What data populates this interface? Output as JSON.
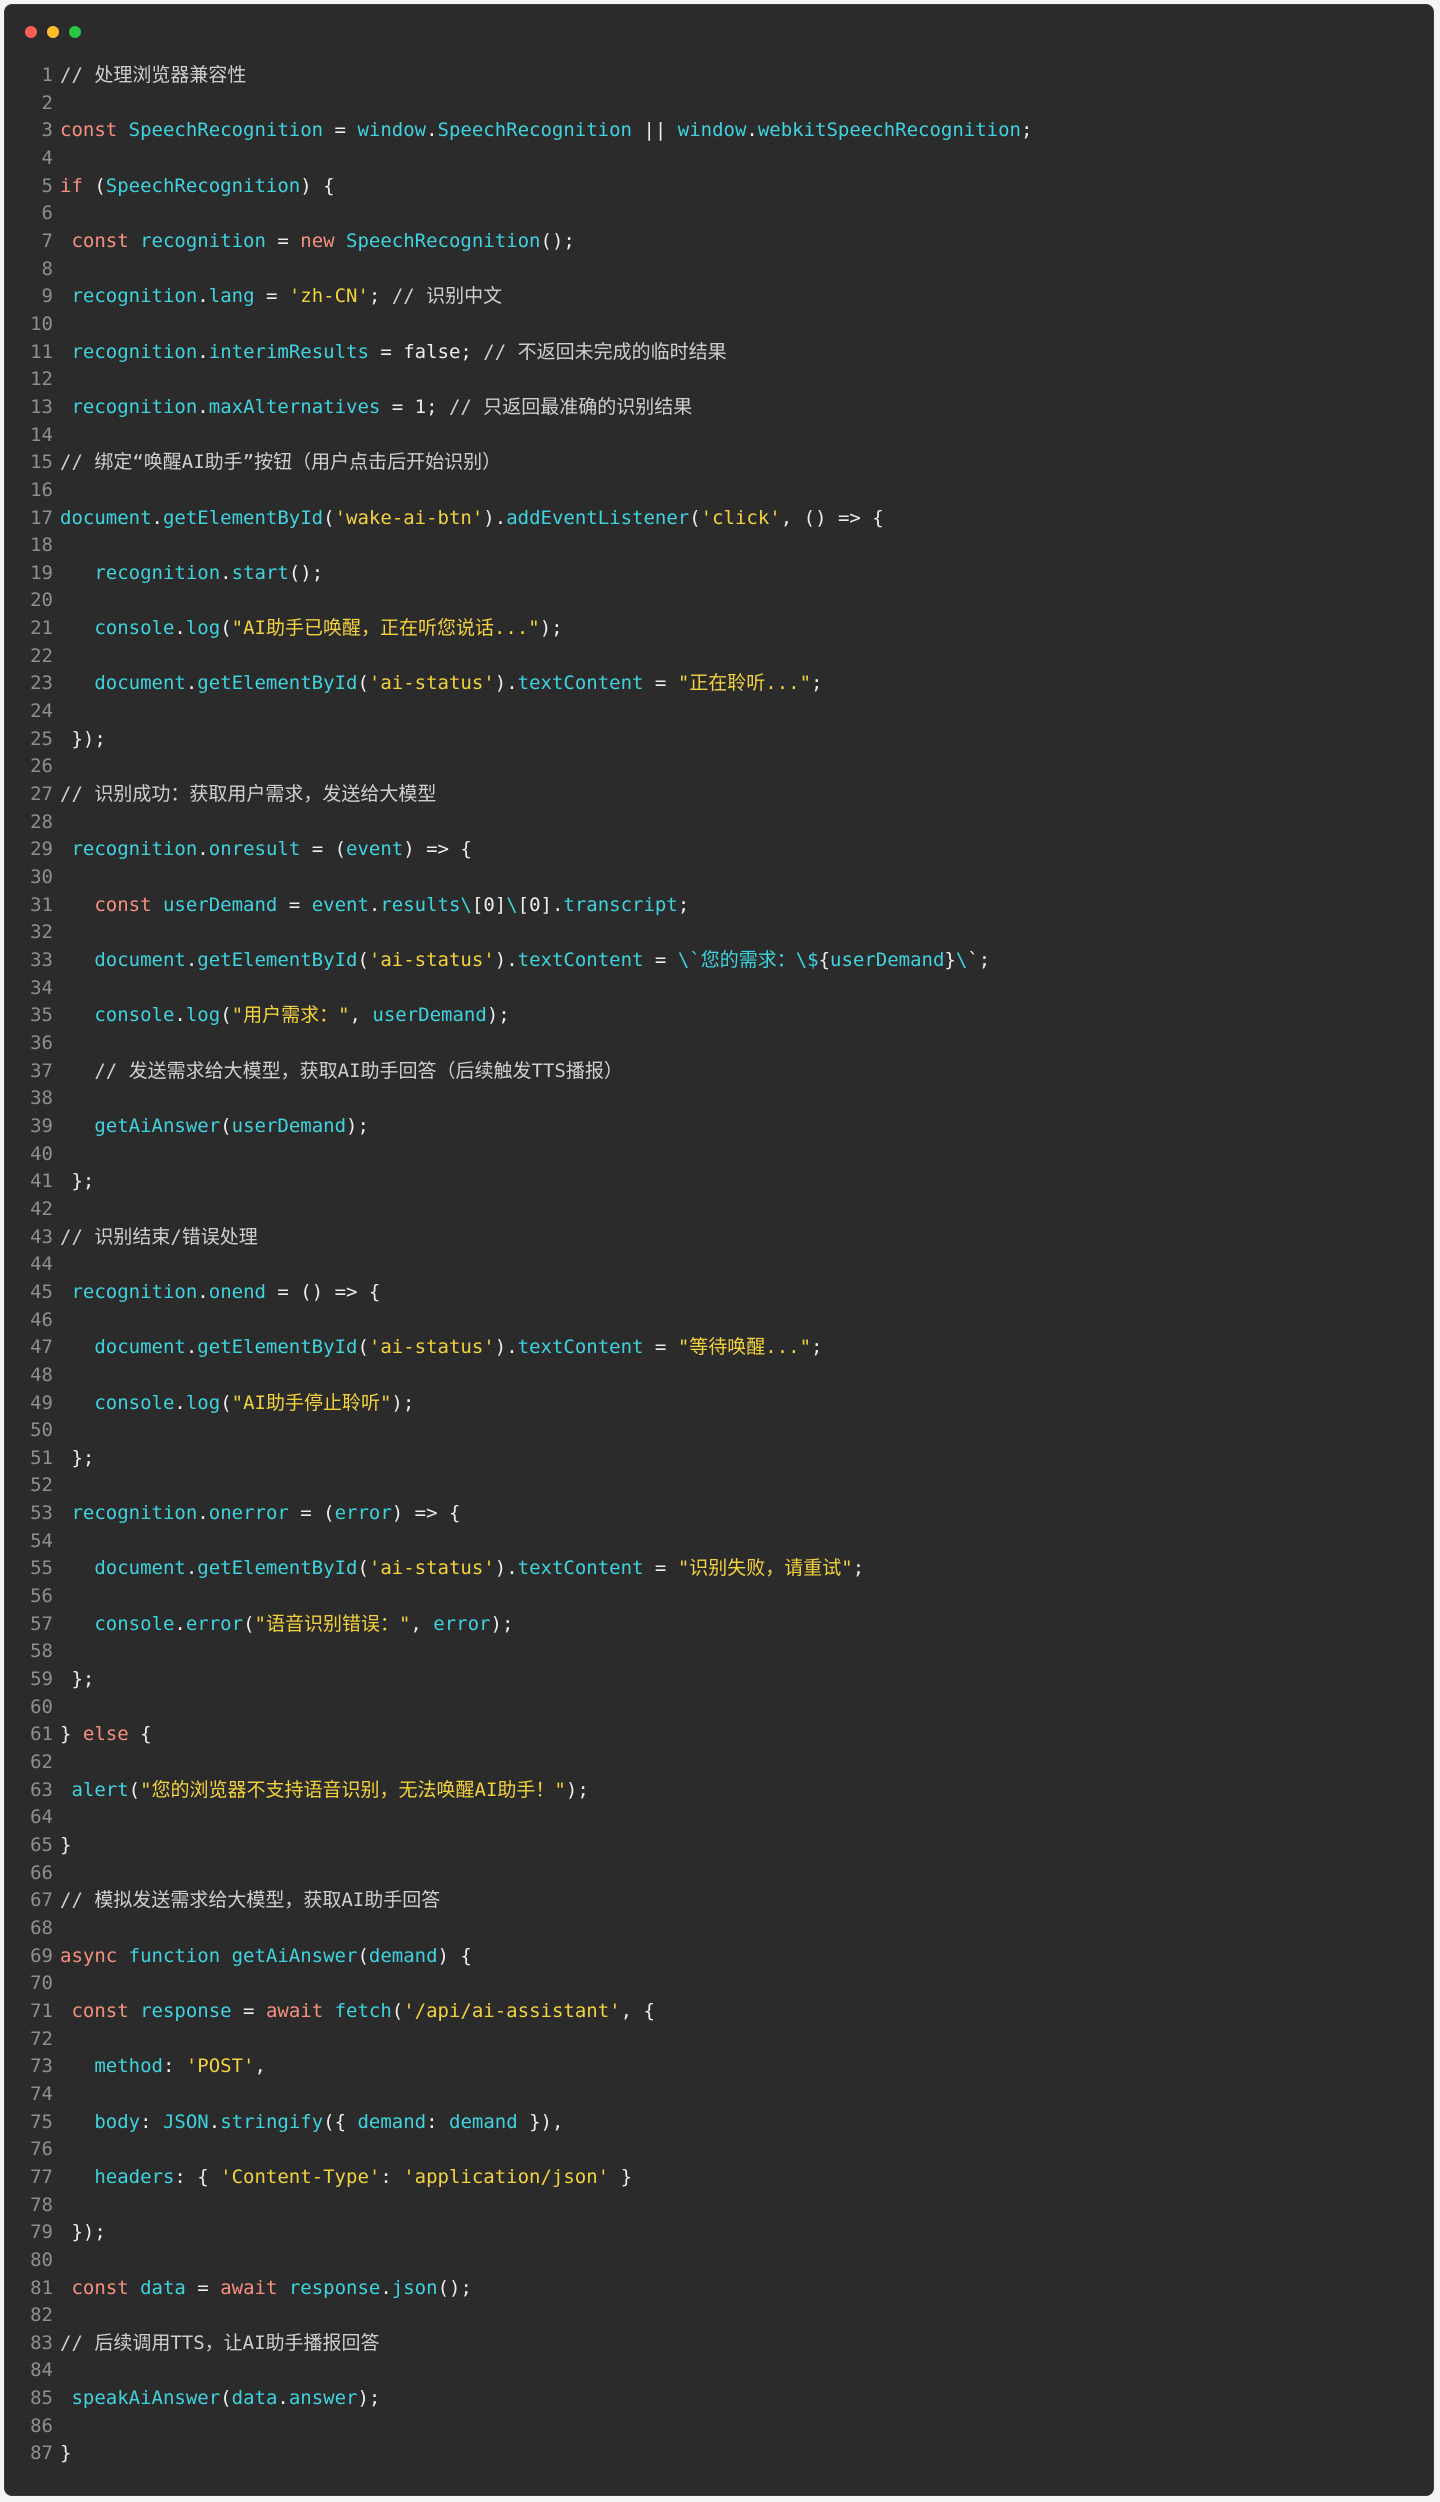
{
  "window": {
    "controls": [
      "close",
      "minimize",
      "zoom"
    ]
  },
  "colors": {
    "background": "#2b2b2b",
    "keyword": "#f6907f",
    "identifier": "#3fd3df",
    "string": "#f3d240",
    "comment": "#cfcfcf",
    "plain": "#ededed",
    "line_number": "#8f8f8f"
  },
  "editor": {
    "lines": [
      [
        [
          "cm",
          "// 处理浏览器兼容性"
        ]
      ],
      [],
      [
        [
          "kw",
          "const "
        ],
        [
          "id",
          "SpeechRecognition"
        ],
        [
          "pl",
          " = "
        ],
        [
          "id",
          "window"
        ],
        [
          "pl",
          "."
        ],
        [
          "id",
          "SpeechRecognition"
        ],
        [
          "pl",
          " || "
        ],
        [
          "id",
          "window"
        ],
        [
          "pl",
          "."
        ],
        [
          "id",
          "webkitSpeechRecognition"
        ],
        [
          "pl",
          ";"
        ]
      ],
      [],
      [
        [
          "kw",
          "if "
        ],
        [
          "pl",
          "("
        ],
        [
          "id",
          "SpeechRecognition"
        ],
        [
          "pl",
          ") {"
        ]
      ],
      [],
      [
        [
          "pl",
          " "
        ],
        [
          "kw",
          "const "
        ],
        [
          "id",
          "recognition"
        ],
        [
          "pl",
          " = "
        ],
        [
          "kw",
          "new "
        ],
        [
          "id",
          "SpeechRecognition"
        ],
        [
          "pl",
          "();"
        ]
      ],
      [],
      [
        [
          "pl",
          " "
        ],
        [
          "id",
          "recognition"
        ],
        [
          "pl",
          "."
        ],
        [
          "id",
          "lang"
        ],
        [
          "pl",
          " = "
        ],
        [
          "str",
          "'zh-CN'"
        ],
        [
          "pl",
          "; "
        ],
        [
          "cm",
          "// 识别中文"
        ]
      ],
      [],
      [
        [
          "pl",
          " "
        ],
        [
          "id",
          "recognition"
        ],
        [
          "pl",
          "."
        ],
        [
          "id",
          "interimResults"
        ],
        [
          "pl",
          " = false; "
        ],
        [
          "cm",
          "// 不返回未完成的临时结果"
        ]
      ],
      [],
      [
        [
          "pl",
          " "
        ],
        [
          "id",
          "recognition"
        ],
        [
          "pl",
          "."
        ],
        [
          "id",
          "maxAlternatives"
        ],
        [
          "pl",
          " = 1; "
        ],
        [
          "cm",
          "// 只返回最准确的识别结果"
        ]
      ],
      [],
      [
        [
          "cm",
          "// 绑定“唤醒AI助手”按钮（用户点击后开始识别）"
        ]
      ],
      [],
      [
        [
          "id",
          "document"
        ],
        [
          "pl",
          "."
        ],
        [
          "id",
          "getElementById"
        ],
        [
          "pl",
          "("
        ],
        [
          "str",
          "'wake-ai-btn'"
        ],
        [
          "pl",
          ")."
        ],
        [
          "id",
          "addEventListener"
        ],
        [
          "pl",
          "("
        ],
        [
          "str",
          "'click'"
        ],
        [
          "pl",
          ", () => {"
        ]
      ],
      [],
      [
        [
          "pl",
          "   "
        ],
        [
          "id",
          "recognition"
        ],
        [
          "pl",
          "."
        ],
        [
          "id",
          "start"
        ],
        [
          "pl",
          "();"
        ]
      ],
      [],
      [
        [
          "pl",
          "   "
        ],
        [
          "id",
          "console"
        ],
        [
          "pl",
          "."
        ],
        [
          "id",
          "log"
        ],
        [
          "pl",
          "("
        ],
        [
          "str",
          "\"AI助手已唤醒，正在听您说话...\""
        ],
        [
          "pl",
          ");"
        ]
      ],
      [],
      [
        [
          "pl",
          "   "
        ],
        [
          "id",
          "document"
        ],
        [
          "pl",
          "."
        ],
        [
          "id",
          "getElementById"
        ],
        [
          "pl",
          "("
        ],
        [
          "str",
          "'ai-status'"
        ],
        [
          "pl",
          ")."
        ],
        [
          "id",
          "textContent"
        ],
        [
          "pl",
          " = "
        ],
        [
          "str",
          "\"正在聆听...\""
        ],
        [
          "pl",
          ";"
        ]
      ],
      [],
      [
        [
          "pl",
          " });"
        ]
      ],
      [],
      [
        [
          "cm",
          "// 识别成功：获取用户需求，发送给大模型"
        ]
      ],
      [],
      [
        [
          "pl",
          " "
        ],
        [
          "id",
          "recognition"
        ],
        [
          "pl",
          "."
        ],
        [
          "id",
          "onresult"
        ],
        [
          "pl",
          " = ("
        ],
        [
          "id",
          "event"
        ],
        [
          "pl",
          ") => {"
        ]
      ],
      [],
      [
        [
          "pl",
          "   "
        ],
        [
          "kw",
          "const "
        ],
        [
          "id",
          "userDemand"
        ],
        [
          "pl",
          " = "
        ],
        [
          "id",
          "event"
        ],
        [
          "pl",
          "."
        ],
        [
          "id",
          "results"
        ],
        [
          "id",
          "\\"
        ],
        [
          "pl",
          "[0]"
        ],
        [
          "id",
          "\\"
        ],
        [
          "pl",
          "[0]."
        ],
        [
          "id",
          "transcript"
        ],
        [
          "pl",
          ";"
        ]
      ],
      [],
      [
        [
          "pl",
          "   "
        ],
        [
          "id",
          "document"
        ],
        [
          "pl",
          "."
        ],
        [
          "id",
          "getElementById"
        ],
        [
          "pl",
          "("
        ],
        [
          "str",
          "'ai-status'"
        ],
        [
          "pl",
          ")."
        ],
        [
          "id",
          "textContent"
        ],
        [
          "pl",
          " = "
        ],
        [
          "id",
          "\\`您的需求：\\$"
        ],
        [
          "pl",
          "{"
        ],
        [
          "id",
          "userDemand"
        ],
        [
          "pl",
          "}"
        ],
        [
          "id",
          "\\"
        ],
        [
          "pl",
          "`;"
        ]
      ],
      [],
      [
        [
          "pl",
          "   "
        ],
        [
          "id",
          "console"
        ],
        [
          "pl",
          "."
        ],
        [
          "id",
          "log"
        ],
        [
          "pl",
          "("
        ],
        [
          "str",
          "\"用户需求：\""
        ],
        [
          "pl",
          ", "
        ],
        [
          "id",
          "userDemand"
        ],
        [
          "pl",
          ");"
        ]
      ],
      [],
      [
        [
          "pl",
          "   "
        ],
        [
          "cm",
          "// 发送需求给大模型，获取AI助手回答（后续触发TTS播报）"
        ]
      ],
      [],
      [
        [
          "pl",
          "   "
        ],
        [
          "id",
          "getAiAnswer"
        ],
        [
          "pl",
          "("
        ],
        [
          "id",
          "userDemand"
        ],
        [
          "pl",
          ");"
        ]
      ],
      [],
      [
        [
          "pl",
          " };"
        ]
      ],
      [],
      [
        [
          "cm",
          "// 识别结束/错误处理"
        ]
      ],
      [],
      [
        [
          "pl",
          " "
        ],
        [
          "id",
          "recognition"
        ],
        [
          "pl",
          "."
        ],
        [
          "id",
          "onend"
        ],
        [
          "pl",
          " = () => {"
        ]
      ],
      [],
      [
        [
          "pl",
          "   "
        ],
        [
          "id",
          "document"
        ],
        [
          "pl",
          "."
        ],
        [
          "id",
          "getElementById"
        ],
        [
          "pl",
          "("
        ],
        [
          "str",
          "'ai-status'"
        ],
        [
          "pl",
          ")."
        ],
        [
          "id",
          "textContent"
        ],
        [
          "pl",
          " = "
        ],
        [
          "str",
          "\"等待唤醒...\""
        ],
        [
          "pl",
          ";"
        ]
      ],
      [],
      [
        [
          "pl",
          "   "
        ],
        [
          "id",
          "console"
        ],
        [
          "pl",
          "."
        ],
        [
          "id",
          "log"
        ],
        [
          "pl",
          "("
        ],
        [
          "str",
          "\"AI助手停止聆听\""
        ],
        [
          "pl",
          ");"
        ]
      ],
      [],
      [
        [
          "pl",
          " };"
        ]
      ],
      [],
      [
        [
          "pl",
          " "
        ],
        [
          "id",
          "recognition"
        ],
        [
          "pl",
          "."
        ],
        [
          "id",
          "onerror"
        ],
        [
          "pl",
          " = ("
        ],
        [
          "id",
          "error"
        ],
        [
          "pl",
          ") => {"
        ]
      ],
      [],
      [
        [
          "pl",
          "   "
        ],
        [
          "id",
          "document"
        ],
        [
          "pl",
          "."
        ],
        [
          "id",
          "getElementById"
        ],
        [
          "pl",
          "("
        ],
        [
          "str",
          "'ai-status'"
        ],
        [
          "pl",
          ")."
        ],
        [
          "id",
          "textContent"
        ],
        [
          "pl",
          " = "
        ],
        [
          "str",
          "\"识别失败，请重试\""
        ],
        [
          "pl",
          ";"
        ]
      ],
      [],
      [
        [
          "pl",
          "   "
        ],
        [
          "id",
          "console"
        ],
        [
          "pl",
          "."
        ],
        [
          "id",
          "error"
        ],
        [
          "pl",
          "("
        ],
        [
          "str",
          "\"语音识别错误：\""
        ],
        [
          "pl",
          ", "
        ],
        [
          "id",
          "error"
        ],
        [
          "pl",
          ");"
        ]
      ],
      [],
      [
        [
          "pl",
          " };"
        ]
      ],
      [],
      [
        [
          "pl",
          "} "
        ],
        [
          "kw",
          "else "
        ],
        [
          "pl",
          "{"
        ]
      ],
      [],
      [
        [
          "pl",
          " "
        ],
        [
          "id",
          "alert"
        ],
        [
          "pl",
          "("
        ],
        [
          "str",
          "\"您的浏览器不支持语音识别，无法唤醒AI助手！\""
        ],
        [
          "pl",
          ");"
        ]
      ],
      [],
      [
        [
          "pl",
          "}"
        ]
      ],
      [],
      [
        [
          "cm",
          "// 模拟发送需求给大模型，获取AI助手回答"
        ]
      ],
      [],
      [
        [
          "kw",
          "async "
        ],
        [
          "id",
          "function "
        ],
        [
          "id",
          "getAiAnswer"
        ],
        [
          "pl",
          "("
        ],
        [
          "id",
          "demand"
        ],
        [
          "pl",
          ") {"
        ]
      ],
      [],
      [
        [
          "pl",
          " "
        ],
        [
          "kw",
          "const "
        ],
        [
          "id",
          "response"
        ],
        [
          "pl",
          " = "
        ],
        [
          "kw",
          "await "
        ],
        [
          "id",
          "fetch"
        ],
        [
          "pl",
          "("
        ],
        [
          "str",
          "'/api/ai-assistant'"
        ],
        [
          "pl",
          ", {"
        ]
      ],
      [],
      [
        [
          "pl",
          "   "
        ],
        [
          "id",
          "method"
        ],
        [
          "pl",
          ": "
        ],
        [
          "str",
          "'POST'"
        ],
        [
          "pl",
          ","
        ]
      ],
      [],
      [
        [
          "pl",
          "   "
        ],
        [
          "id",
          "body"
        ],
        [
          "pl",
          ": "
        ],
        [
          "id",
          "JSON"
        ],
        [
          "pl",
          "."
        ],
        [
          "id",
          "stringify"
        ],
        [
          "pl",
          "({ "
        ],
        [
          "id",
          "demand"
        ],
        [
          "pl",
          ": "
        ],
        [
          "id",
          "demand"
        ],
        [
          "pl",
          " }),"
        ]
      ],
      [],
      [
        [
          "pl",
          "   "
        ],
        [
          "id",
          "headers"
        ],
        [
          "pl",
          ": { "
        ],
        [
          "str",
          "'Content-Type'"
        ],
        [
          "pl",
          ": "
        ],
        [
          "str",
          "'application/json'"
        ],
        [
          "pl",
          " }"
        ]
      ],
      [],
      [
        [
          "pl",
          " });"
        ]
      ],
      [],
      [
        [
          "pl",
          " "
        ],
        [
          "kw",
          "const "
        ],
        [
          "id",
          "data"
        ],
        [
          "pl",
          " = "
        ],
        [
          "kw",
          "await "
        ],
        [
          "id",
          "response"
        ],
        [
          "pl",
          "."
        ],
        [
          "id",
          "json"
        ],
        [
          "pl",
          "();"
        ]
      ],
      [],
      [
        [
          "cm",
          "// 后续调用TTS，让AI助手播报回答"
        ]
      ],
      [],
      [
        [
          "pl",
          " "
        ],
        [
          "id",
          "speakAiAnswer"
        ],
        [
          "pl",
          "("
        ],
        [
          "id",
          "data"
        ],
        [
          "pl",
          "."
        ],
        [
          "id",
          "answer"
        ],
        [
          "pl",
          ");"
        ]
      ],
      [],
      [
        [
          "pl",
          "}"
        ]
      ]
    ]
  }
}
